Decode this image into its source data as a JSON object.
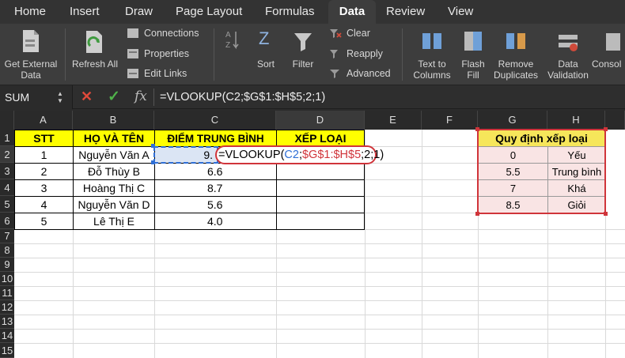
{
  "menu": {
    "tabs": [
      {
        "label": "Home",
        "active": false
      },
      {
        "label": "Insert",
        "active": false
      },
      {
        "label": "Draw",
        "active": false
      },
      {
        "label": "Page Layout",
        "active": false
      },
      {
        "label": "Formulas",
        "active": false
      },
      {
        "label": "Data",
        "active": true
      },
      {
        "label": "Review",
        "active": false
      },
      {
        "label": "View",
        "active": false
      }
    ]
  },
  "ribbon": {
    "get_external_data": "Get External Data",
    "refresh_all": "Refresh All",
    "connections": "Connections",
    "properties": "Properties",
    "edit_links": "Edit Links",
    "sort": "Sort",
    "filter": "Filter",
    "clear": "Clear",
    "reapply": "Reapply",
    "advanced": "Advanced",
    "text_to_columns": "Text to Columns",
    "flash_fill": "Flash Fill",
    "remove_duplicates": "Remove Duplicates",
    "data_validation": "Data Validation",
    "consolidate": "Consol"
  },
  "formula_bar": {
    "name_box": "SUM",
    "formula": "=VLOOKUP(C2;$G$1:$H$5;2;1)"
  },
  "sheet": {
    "columns": [
      "A",
      "B",
      "C",
      "D",
      "E",
      "F",
      "G",
      "H"
    ],
    "rows": [
      "1",
      "2",
      "3",
      "4",
      "5",
      "6",
      "7",
      "8",
      "9",
      "10",
      "11",
      "12",
      "13",
      "14",
      "15"
    ],
    "headers": {
      "stt": "STT",
      "name": "HỌ VÀ TÊN",
      "score": "ĐIỂM TRUNG BÌNH",
      "rank": "XẾP LOẠI"
    },
    "students": [
      {
        "stt": "1",
        "name": "Nguyễn Văn A",
        "score": "9."
      },
      {
        "stt": "2",
        "name": "Đỗ Thùy B",
        "score": "6.6"
      },
      {
        "stt": "3",
        "name": "Hoàng Thị C",
        "score": "8.7"
      },
      {
        "stt": "4",
        "name": "Nguyễn Văn D",
        "score": "5.6"
      },
      {
        "stt": "5",
        "name": "Lê Thị E",
        "score": "4.0"
      }
    ],
    "editing_formula": {
      "prefix": "=VLOOKUP(",
      "ref1": "C2",
      "sep1": ";",
      "ref2": "$G$1:$H$5",
      "suffix": ";2;1)"
    },
    "lookup_table": {
      "title": "Quy định xếp loại",
      "rows": [
        {
          "min": "0",
          "label": "Yếu"
        },
        {
          "min": "5.5",
          "label": "Trung bình"
        },
        {
          "min": "7",
          "label": "Khá"
        },
        {
          "min": "8.5",
          "label": "Giỏi"
        }
      ]
    }
  },
  "colors": {
    "header_yellow": "#ffff00",
    "lookup_header": "#f6e65a",
    "lookup_fill": "#f9e4e4",
    "ref_blue": "#2f6fd6",
    "ref_red": "#d0343a",
    "active_tab": "#3d3d3d"
  }
}
